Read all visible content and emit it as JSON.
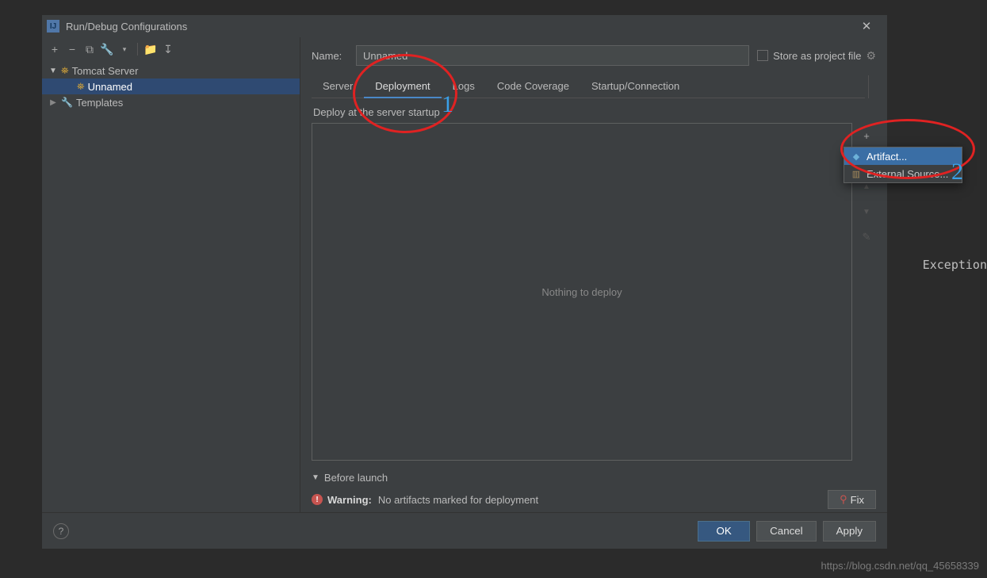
{
  "dialog": {
    "title": "Run/Debug Configurations",
    "close_glyph": "✕"
  },
  "sidebar_toolbar": {
    "add": "+",
    "remove": "−",
    "copy": "⧉",
    "settings": "🔧",
    "chev": "▾",
    "folder": "📁",
    "sort": "↧"
  },
  "tree": {
    "tomcat_label": "Tomcat Server",
    "unnamed_label": "Unnamed",
    "templates_label": "Templates"
  },
  "name_row": {
    "label": "Name:",
    "value": "Unnamed",
    "store_label": "Store as project file",
    "gear": "⚙"
  },
  "tabs": {
    "server": "Server",
    "deployment": "Deployment",
    "logs": "Logs",
    "coverage": "Code Coverage",
    "startup": "Startup/Connection"
  },
  "deploy": {
    "section_label": "Deploy at the server startup",
    "empty_text": "Nothing to deploy",
    "tools": {
      "add": "+",
      "remove": "−",
      "up": "▲",
      "down": "▼",
      "edit": "✎"
    }
  },
  "popup": {
    "artifact": "Artifact...",
    "external": "External Source..."
  },
  "before_launch": {
    "chev": "▼",
    "label": "Before launch"
  },
  "warning": {
    "prefix": "Warning:",
    "text": "No artifacts marked for deployment",
    "fix_label": "Fix",
    "bulb": "⚲"
  },
  "footer": {
    "help": "?",
    "ok": "OK",
    "cancel": "Cancel",
    "apply": "Apply"
  },
  "annotations": {
    "one": "1",
    "two": "2"
  },
  "background_text": "Exception",
  "watermark": "https://blog.csdn.net/qq_45658339"
}
